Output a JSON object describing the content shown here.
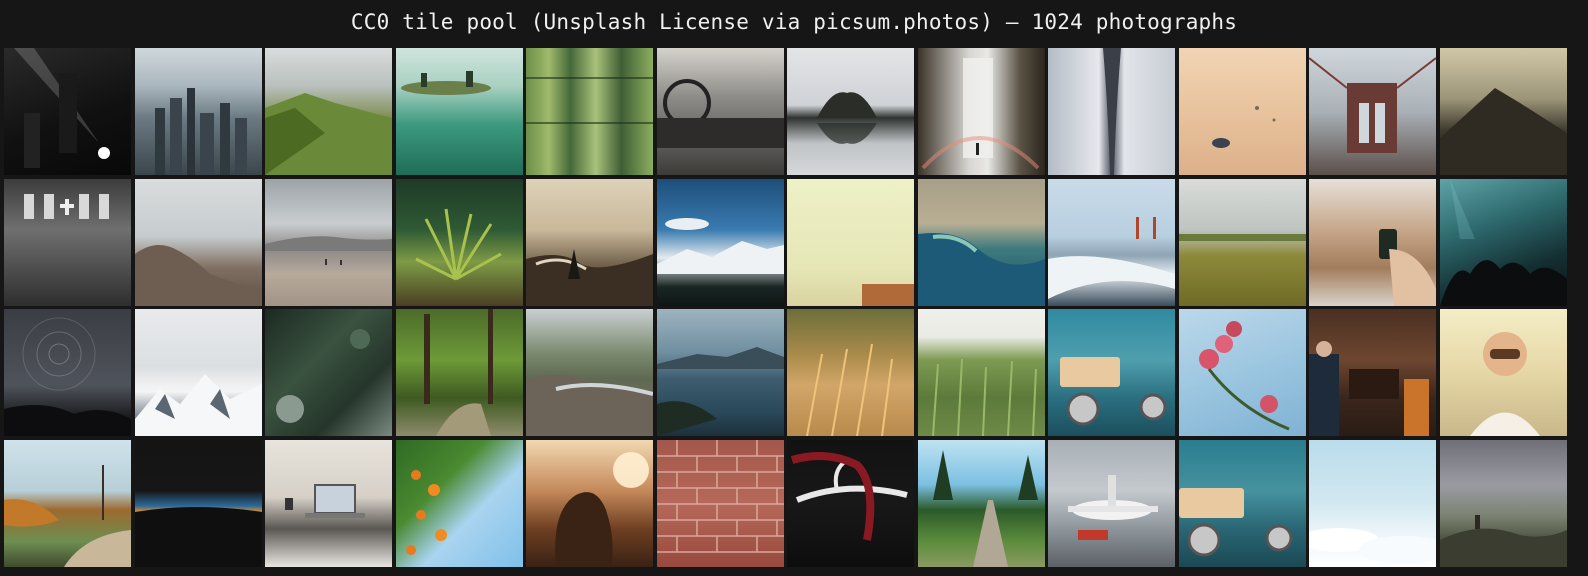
{
  "header": {
    "title": "CC0 tile pool (Unsplash License via picsum.photos) — 1024 photographs"
  },
  "tiles": [
    {
      "subject": "concert-stage-bw",
      "bg": "linear-gradient(160deg,#2a2a2a 0%,#111 55%,#080808 100%)"
    },
    {
      "subject": "city-skyline",
      "bg": "linear-gradient(180deg,#cfd8dc 0%,#aab6bd 30%,#6b7a83 55%,#3b454c 100%)"
    },
    {
      "subject": "green-mountain-ridge",
      "bg": "linear-gradient(180deg,#d9dcdc 0%,#b9c0bd 30%,#7e8f52 55%,#5a6e2c 100%)"
    },
    {
      "subject": "canoe-teal-lake",
      "bg": "linear-gradient(180deg,#cfe4de 0%,#a9d1c2 30%,#3d9a7f 60%,#1f6d57 100%)"
    },
    {
      "subject": "bamboo",
      "bg": "linear-gradient(90deg,#6b8f48 0%,#9fba6b 18%,#46683a 35%,#a9c27a 55%,#3f5e35 75%,#8bae5f 100%)"
    },
    {
      "subject": "vintage-car-dashboard",
      "bg": "linear-gradient(180deg,#d5d2cc 0%,#8c8a86 40%,#3d3b39 100%)"
    },
    {
      "subject": "sea-rock-reflection",
      "bg": "linear-gradient(180deg,#e3e4e6 0%,#cfd2d6 45%,#2f3330 55%,#bfc3c6 75%,#d6d8da 100%)"
    },
    {
      "subject": "waterfall-rainbow",
      "bg": "linear-gradient(90deg,#3a3328 0%,#d8d6d2 40%,#e8e8e6 55%,#5c5446 80%,#2b251d 100%)"
    },
    {
      "subject": "abstract-grey-pillar",
      "bg": "linear-gradient(90deg,#b4bcc6 0%,#e6e8ec 40%,#4f5662 50%,#e2e5ea 60%,#c6ccd4 100%)"
    },
    {
      "subject": "sand-pebble",
      "bg": "linear-gradient(180deg,#f1d4b4 0%,#e8c39d 50%,#dcb08a 100%)"
    },
    {
      "subject": "brooklyn-bridge",
      "bg": "linear-gradient(180deg,#cfd6dc 0%,#a9b1b7 50%,#5c4f4a 100%)"
    },
    {
      "subject": "misty-volcano",
      "bg": "linear-gradient(180deg,#cfc7a7 0%,#9d9578 40%,#3d3a2e 65%,#1f1e19 100%)"
    },
    {
      "subject": "church-interior-bw",
      "bg": "linear-gradient(180deg,#3c3c3c 0%,#6f6f6f 40%,#2e2e2e 100%)"
    },
    {
      "subject": "rocky-coast",
      "bg": "linear-gradient(180deg,#d9dcdd 0%,#c6ccce 45%,#806f62 70%,#5e4e42 100%)"
    },
    {
      "subject": "beach-hazy-hills",
      "bg": "linear-gradient(180deg,#9da3a8 0%,#c9cdcf 35%,#8c8a88 55%,#b7aa9b 75%,#a19385 100%)"
    },
    {
      "subject": "fern-forest-floor",
      "bg": "linear-gradient(180deg,#1e3a26 0%,#2f5a34 40%,#7e9a46 65%,#4a3f22 100%)"
    },
    {
      "subject": "river-valley-sunset",
      "bg": "linear-gradient(180deg,#ddd2b9 0%,#c9b89a 40%,#6b5a45 70%,#2f271e 100%)"
    },
    {
      "subject": "snowy-mountains-blue",
      "bg": "linear-gradient(180deg,#1d4e7a 0%,#3a7bb0 40%,#e4eaee 62%,#1a2624 85%,#0f1614 100%)"
    },
    {
      "subject": "pale-yellow-minimal",
      "bg": "linear-gradient(180deg,#eef0c7 0%,#e6e7b6 70%,#d9d3a0 100%)"
    },
    {
      "subject": "aerial-coastline",
      "bg": "linear-gradient(180deg,#a89f89 0%,#b8ae93 35%,#3d7a7d 55%,#1b4e6a 100%)"
    },
    {
      "subject": "golden-gate-surf",
      "bg": "linear-gradient(180deg,#c9dbe9 0%,#b8cfe0 45%,#8ea4b4 60%,#e4ecf0 75%,#3b4c5c 100%)"
    },
    {
      "subject": "wheat-field-sky",
      "bg": "linear-gradient(180deg,#d9dcd8 0%,#bfc4c0 40%,#8e8a3b 60%,#6f6a25 100%)"
    },
    {
      "subject": "hand-holding-phone-table",
      "bg": "linear-gradient(180deg,#e6e0d8 0%,#c7a78a 40%,#a27d5c 70%,#d9d2c9 100%)"
    },
    {
      "subject": "concert-crowd",
      "bg": "linear-gradient(160deg,#5fa3a6 0%,#2e6b6f 35%,#142e31 70%,#0a1416 100%)"
    },
    {
      "subject": "star-trails",
      "bg": "linear-gradient(180deg,#3a3d44 0%,#4f535b 60%,#1a1b1e 85%,#0e0e10 100%)"
    },
    {
      "subject": "snowy-peaks",
      "bg": "linear-gradient(180deg,#e8eaec 0%,#dcdfe2 45%,#f4f5f6 65%,#7e8792 85%,#c8cdd3 100%)"
    },
    {
      "subject": "dark-pine-closeup",
      "bg": "linear-gradient(135deg,#1c2a22 0%,#3a5240 40%,#25352b 70%,#7a8a80 100%)"
    },
    {
      "subject": "forest-path-green",
      "bg": "linear-gradient(180deg,#4b6b2a 0%,#6e9a38 40%,#3f5a22 70%,#8d8b6a 100%)"
    },
    {
      "subject": "river-canyon",
      "bg": "linear-gradient(180deg,#c9cfd3 0%,#7b8a6e 35%,#5e6a52 55%,#7a6e60 80%,#4a4038 100%)"
    },
    {
      "subject": "lake-mountains-blue",
      "bg": "linear-gradient(180deg,#9db4c1 0%,#6e8e9f 35%,#3e5d70 55%,#2a4a5c 80%,#1d2f3a 100%)"
    },
    {
      "subject": "wheat-golden",
      "bg": "linear-gradient(180deg,#6d6e3a 0%,#a88a4a 35%,#d2a668 60%,#b88b4d 100%)"
    },
    {
      "subject": "green-wheat",
      "bg": "linear-gradient(180deg,#f0f0ea 0%,#e9ebe4 22%,#7e9a52 40%,#5c7a3a 70%,#6e8a48 100%)"
    },
    {
      "subject": "tuktuk-teal-956",
      "bg": "linear-gradient(180deg,#2f8aa0 0%,#4f9fae 40%,#2a6f80 70%,#1c4f5d 100%)"
    },
    {
      "subject": "pink-flowers-sky",
      "bg": "linear-gradient(160deg,#bcd8ea 0%,#9cc6e0 50%,#7fb2d4 100%)"
    },
    {
      "subject": "cafe-interior",
      "bg": "linear-gradient(180deg,#4a2f22 0%,#6e4630 40%,#3a261c 70%,#2a1c15 100%)"
    },
    {
      "subject": "woman-sunglasses-field",
      "bg": "linear-gradient(180deg,#f4edc6 0%,#e6d7a6 50%,#c9b88a 100%)"
    },
    {
      "subject": "autumn-river-path",
      "bg": "linear-gradient(180deg,#cfe2ea 0%,#b7cfd8 40%,#9c6a2e 55%,#6e8e52 80%,#3f4a2e 100%)"
    },
    {
      "subject": "dusk-horizon",
      "bg": "linear-gradient(180deg,#141414 0%,#161616 40%,#2b6a9a 52%,#d08a35 56%,#121212 62%,#0e0e0e 100%)"
    },
    {
      "subject": "laptop-desk-window",
      "bg": "linear-gradient(180deg,#e8e3dc 0%,#d6d0c7 45%,#5b5853 70%,#e9e6e1 100%)"
    },
    {
      "subject": "orange-tree-sky",
      "bg": "linear-gradient(135deg,#2f6a24 0%,#4a8a30 35%,#a9d4ef 60%,#7fc0ea 100%)"
    },
    {
      "subject": "woman-sunset-backlit",
      "bg": "linear-gradient(180deg,#f2d8b0 0%,#c4895a 40%,#6e3f22 70%,#3a2214 100%)"
    },
    {
      "subject": "red-brick-wall",
      "bg": "linear-gradient(180deg,#a3574a 0%,#b6695a 50%,#98493d 100%)"
    },
    {
      "subject": "antler-red-scarf-dark",
      "bg": "linear-gradient(180deg,#121212 0%,#181818 50%,#0d0d0d 100%)"
    },
    {
      "subject": "trail-pine-trees",
      "bg": "linear-gradient(180deg,#bfe3f2 0%,#7cc0e2 35%,#2b5a2a 55%,#5c8c3c 80%,#8c9a62 100%)"
    },
    {
      "subject": "airport-plane",
      "bg": "linear-gradient(180deg,#a8b0b6 0%,#c4c9cd 40%,#8d959b 70%,#5c6166 100%)"
    },
    {
      "subject": "tuktuk-teal-956-dup",
      "bg": "linear-gradient(180deg,#2a7d8f 0%,#46929f 40%,#2a6674 70%,#1b4954 100%)"
    },
    {
      "subject": "clouds-above",
      "bg": "linear-gradient(180deg,#b9dceb 0%,#d2e8f1 50%,#eef6fa 75%,#ffffff 100%)"
    },
    {
      "subject": "hiker-mist-valley",
      "bg": "linear-gradient(180deg,#6e6f78 0%,#9a9ba2 35%,#7b8272 60%,#4a4e3e 80%,#3a3c30 100%)"
    }
  ]
}
